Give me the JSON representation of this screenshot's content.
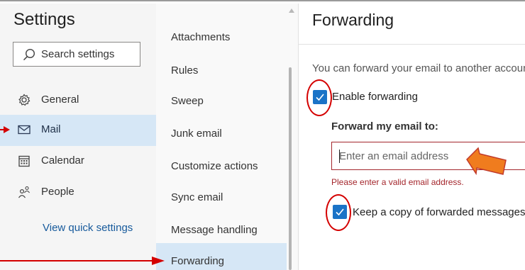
{
  "settings": {
    "title": "Settings",
    "search_placeholder": "Search settings",
    "nav": [
      {
        "label": "General",
        "icon": "gear-icon",
        "selected": false
      },
      {
        "label": "Mail",
        "icon": "mail-icon",
        "selected": true
      },
      {
        "label": "Calendar",
        "icon": "calendar-icon",
        "selected": false
      },
      {
        "label": "People",
        "icon": "people-icon",
        "selected": false
      }
    ],
    "quick_settings_link": "View quick settings"
  },
  "mail_menu": {
    "items": [
      {
        "label": "Attachments",
        "selected": false
      },
      {
        "label": "Rules",
        "selected": false
      },
      {
        "label": "Sweep",
        "selected": false
      },
      {
        "label": "Junk email",
        "selected": false
      },
      {
        "label": "Customize actions",
        "selected": false
      },
      {
        "label": "Sync email",
        "selected": false
      },
      {
        "label": "Message handling",
        "selected": false
      },
      {
        "label": "Forwarding",
        "selected": true
      }
    ]
  },
  "forwarding": {
    "title": "Forwarding",
    "intro": "You can forward your email to another account.",
    "enable_label": "Enable forwarding",
    "enable_checked": true,
    "forward_to_label": "Forward my email to:",
    "email_placeholder": "Enter an email address",
    "email_value": "",
    "error_text": "Please enter a valid email address.",
    "keep_copy_label": "Keep a copy of forwarded messages",
    "keep_copy_checked": true
  },
  "colors": {
    "accent": "#1a73c7",
    "selected_bg": "#d6e7f6",
    "error": "#a4262c",
    "annotation_red": "#d40000",
    "annotation_orange": "#f07c1e",
    "link": "#175a9c"
  }
}
